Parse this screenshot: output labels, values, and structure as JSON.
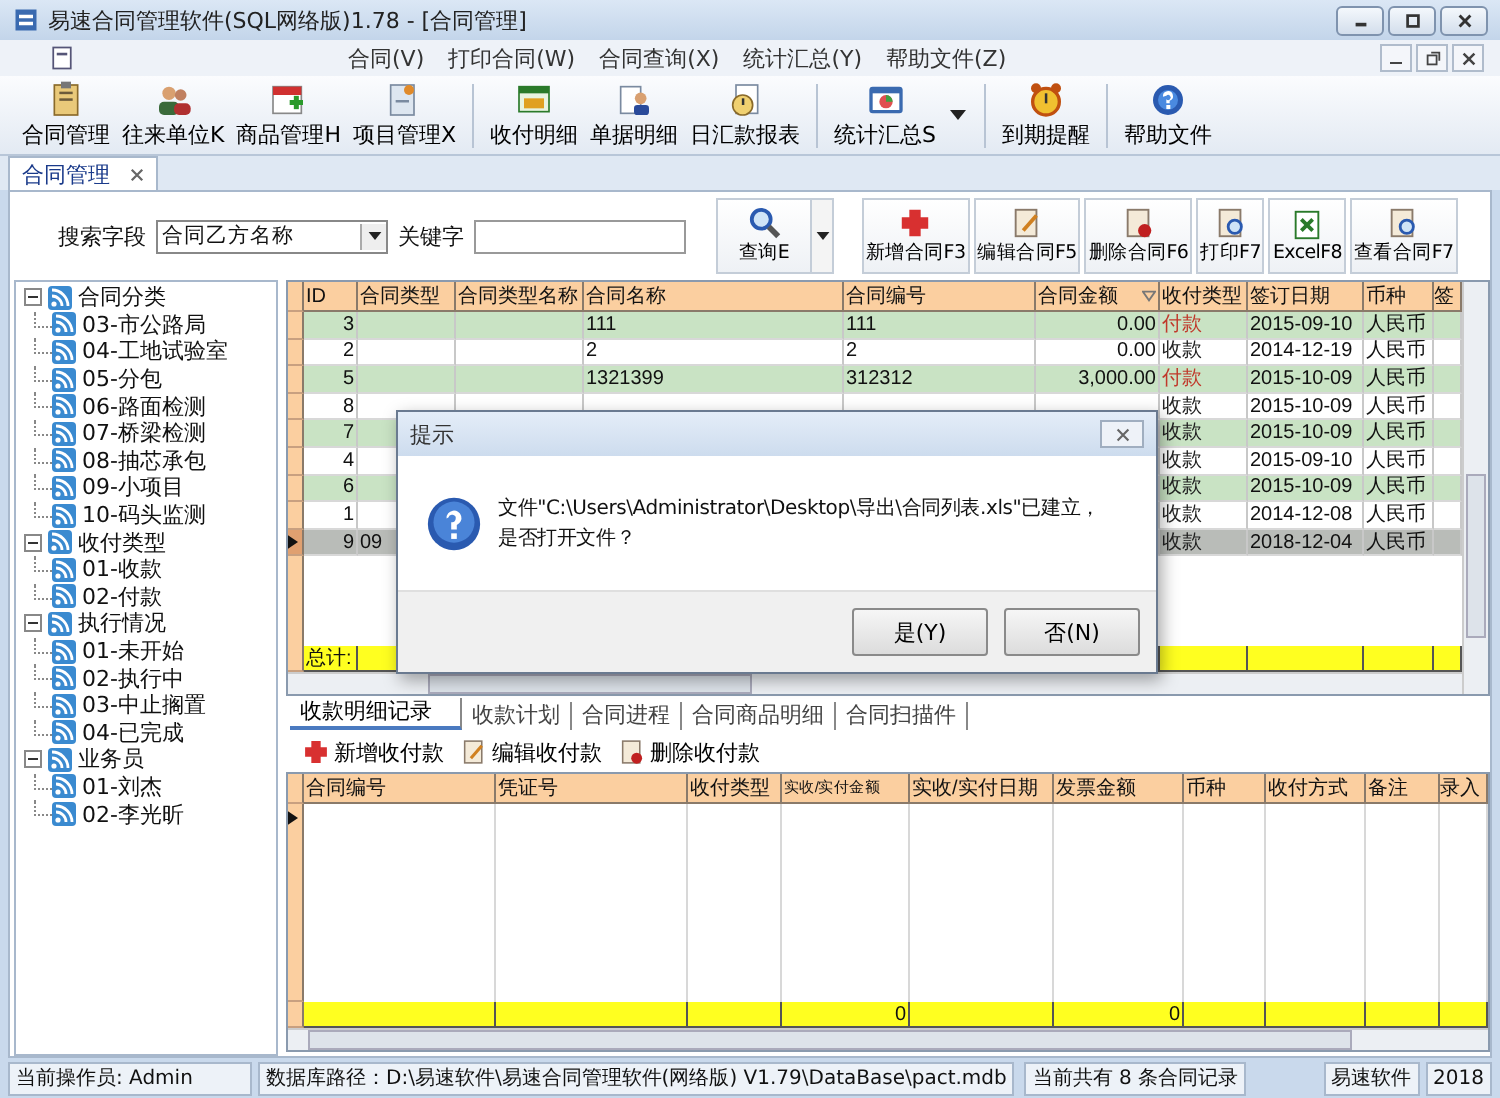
{
  "window": {
    "title": "易速合同管理软件(SQL网络版)1.78 - [合同管理]"
  },
  "menu": [
    "合同(V)",
    "打印合同(W)",
    "合同查询(X)",
    "统计汇总(Y)",
    "帮助文件(Z)"
  ],
  "toolbar": [
    {
      "label": "合同管理"
    },
    {
      "label": "往来单位K"
    },
    {
      "label": "商品管理H"
    },
    {
      "label": "项目管理X"
    },
    {
      "label": "收付明细"
    },
    {
      "label": "单据明细"
    },
    {
      "label": "日汇款报表"
    },
    {
      "label": "统计汇总S"
    },
    {
      "label": "到期提醒"
    },
    {
      "label": "帮助文件"
    }
  ],
  "doc_tabs": [
    {
      "label": "合同管理",
      "selected": true
    }
  ],
  "search": {
    "field_label": "搜索字段",
    "field_value": "合同乙方名称",
    "keyword_label": "关键字",
    "query_button": "查询E"
  },
  "actions": [
    "新增合同F3",
    "编辑合同F5",
    "删除合同F6",
    "打印F7",
    "ExcelF8",
    "查看合同F7"
  ],
  "tree": [
    {
      "label": "合同分类",
      "expanded": true,
      "children": [
        {
          "label": "03-市公路局"
        },
        {
          "label": "04-工地试验室"
        },
        {
          "label": "05-分包"
        },
        {
          "label": "06-路面检测"
        },
        {
          "label": "07-桥梁检测"
        },
        {
          "label": "08-抽芯承包"
        },
        {
          "label": "09-小项目"
        },
        {
          "label": "10-码头监测"
        }
      ]
    },
    {
      "label": "收付类型",
      "expanded": true,
      "children": [
        {
          "label": "01-收款"
        },
        {
          "label": "02-付款"
        }
      ]
    },
    {
      "label": "执行情况",
      "expanded": true,
      "children": [
        {
          "label": "01-未开始"
        },
        {
          "label": "02-执行中"
        },
        {
          "label": "03-中止搁置"
        },
        {
          "label": "04-已完成"
        }
      ]
    },
    {
      "label": "业务员",
      "expanded": true,
      "children": [
        {
          "label": "01-刘杰"
        },
        {
          "label": "02-李光昕"
        }
      ]
    }
  ],
  "table": {
    "columns": [
      "ID",
      "合同类型",
      "合同类型名称",
      "合同名称",
      "合同编号",
      "合同金额",
      "收付类型",
      "签订日期",
      "币种",
      "签"
    ],
    "rows": [
      {
        "id": "3",
        "name": "111",
        "number": "111",
        "amount": "0.00",
        "pay": "付款",
        "color": "#c0392b",
        "date": "2015-09-10",
        "currency": "人民币",
        "selected": false
      },
      {
        "id": "2",
        "name": "2",
        "number": "2",
        "amount": "0.00",
        "pay": "收款",
        "color": "#222222",
        "date": "2014-12-19",
        "currency": "人民币",
        "selected": false
      },
      {
        "id": "5",
        "name": "1321399",
        "number": "312312",
        "amount": "3,000.00",
        "pay": "付款",
        "color": "#c0392b",
        "date": "2015-10-09",
        "currency": "人民币",
        "selected": false
      },
      {
        "id": "8",
        "pay": "收款",
        "color": "#222222",
        "date": "2015-10-09",
        "currency": "人民币",
        "selected": false
      },
      {
        "id": "7",
        "pay": "收款",
        "color": "#222222",
        "date": "2015-10-09",
        "currency": "人民币",
        "selected": false
      },
      {
        "id": "4",
        "pay": "收款",
        "color": "#222222",
        "date": "2015-09-10",
        "currency": "人民币",
        "selected": false
      },
      {
        "id": "6",
        "pay": "收款",
        "color": "#222222",
        "date": "2015-10-09",
        "currency": "人民币",
        "selected": false
      },
      {
        "id": "1",
        "pay": "收款",
        "color": "#222222",
        "date": "2014-12-08",
        "currency": "人民币",
        "selected": false
      },
      {
        "id": "9",
        "type": "09",
        "pay": "收款",
        "color": "#222222",
        "date": "2018-12-04",
        "currency": "人民币",
        "selected": true
      }
    ],
    "total_label": "总计:"
  },
  "detail_tabs": [
    {
      "label": "收款明细记录",
      "selected": true
    },
    {
      "label": "收款计划",
      "selected": false
    },
    {
      "label": "合同进程",
      "selected": false
    },
    {
      "label": "合同商品明细",
      "selected": false
    },
    {
      "label": "合同扫描件",
      "selected": false
    }
  ],
  "detail_actions": [
    "新增收付款",
    "编辑收付款",
    "删除收付款"
  ],
  "detail_table": {
    "columns": [
      {
        "label": "合同编号"
      },
      {
        "label": "凭证号"
      },
      {
        "label": "收付类型"
      },
      {
        "label": "实收/实付金额",
        "total": "0"
      },
      {
        "label": "实收/实付日期"
      },
      {
        "label": "发票金额",
        "total": "0"
      },
      {
        "label": "币种"
      },
      {
        "label": "收付方式"
      },
      {
        "label": "备注"
      },
      {
        "label": "录入"
      }
    ]
  },
  "dialog": {
    "title": "提示",
    "message_lines": [
      "文件\"C:\\Users\\Administrator\\Desktop\\导出\\合同列表.xls\"已建立，",
      "是否打开文件？"
    ],
    "buttons": [
      "是(Y)",
      "否(N)"
    ]
  },
  "status_bar": [
    "当前操作员: Admin",
    "数据库路径：D:\\易速软件\\易速合同管理软件(网络版) V1.79\\DataBase\\pact.mdb",
    "当前共有 8 条合同记录",
    "易速软件",
    "2018"
  ]
}
